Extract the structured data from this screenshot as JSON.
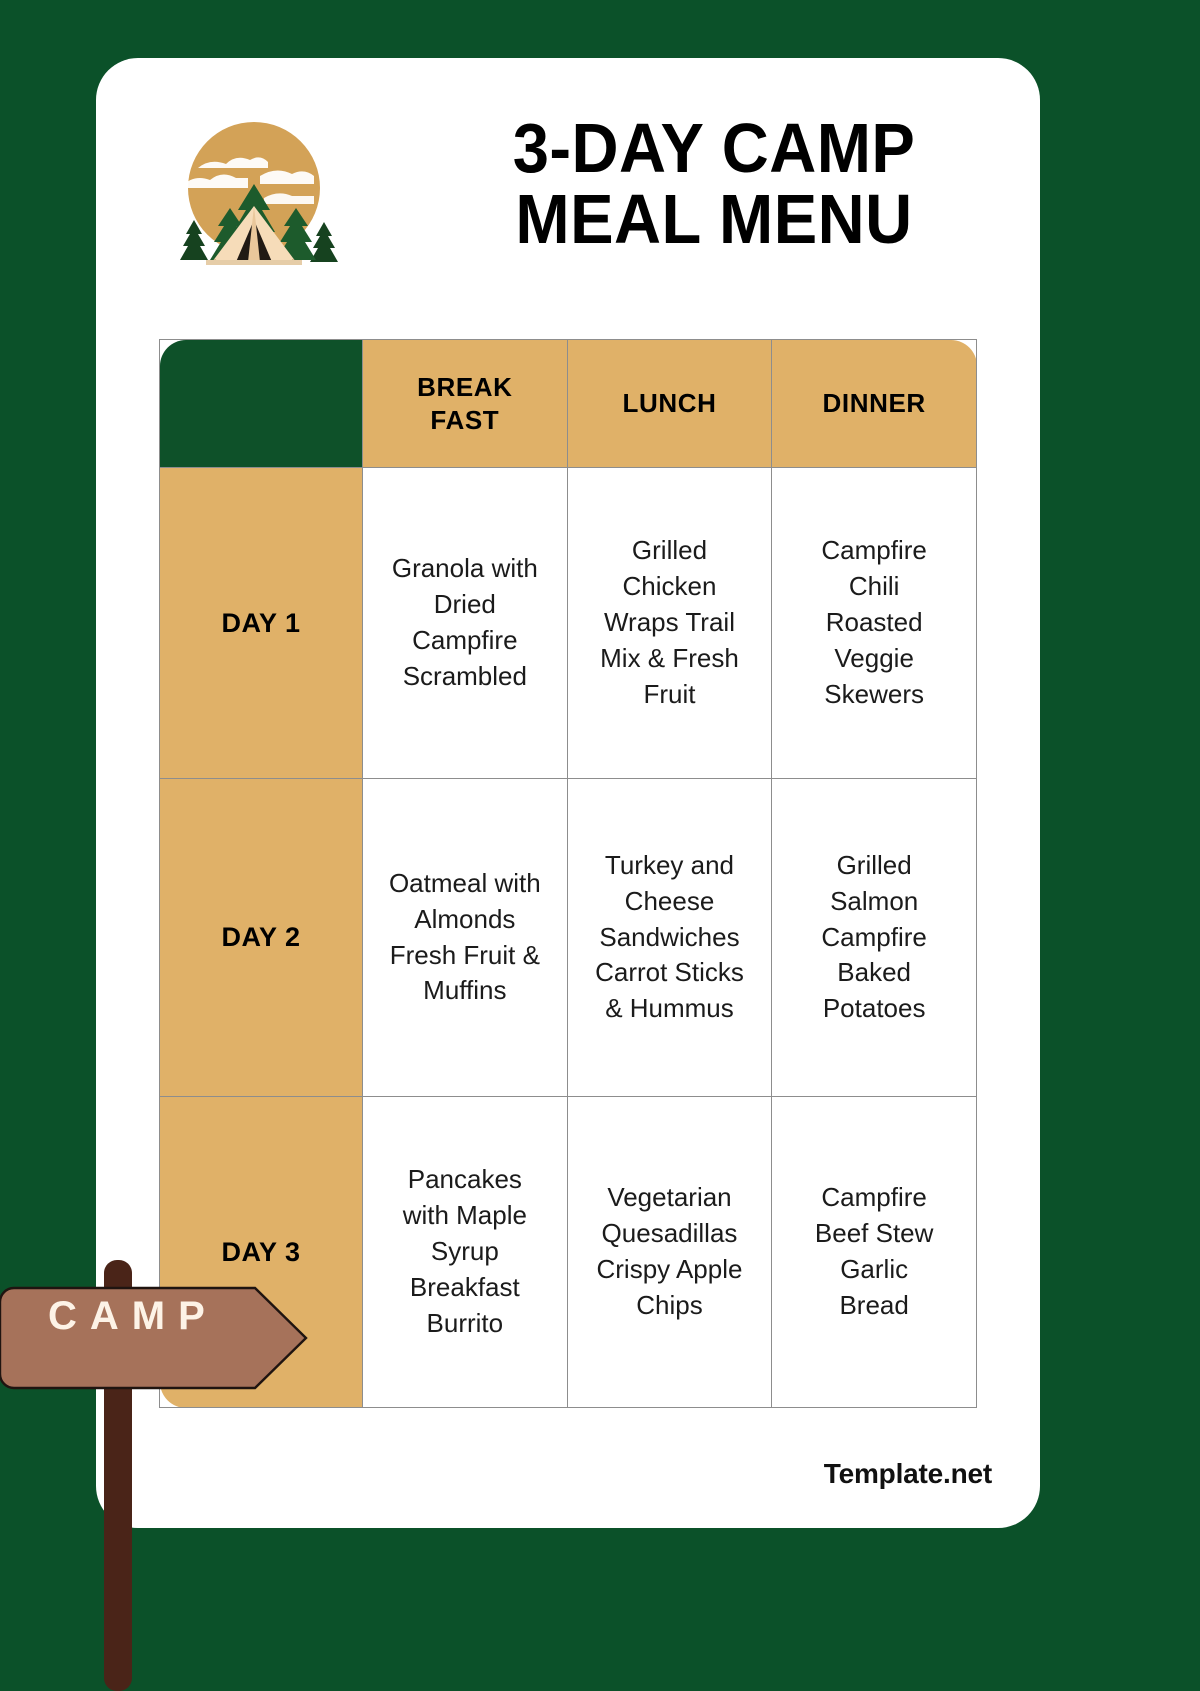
{
  "page": {
    "background_color": "#0b5129",
    "card_color": "#ffffff"
  },
  "header": {
    "title_line1": "3-DAY CAMP",
    "title_line2": "MEAL MENU",
    "logo_name": "camp-tent-forest-logo"
  },
  "colors": {
    "green": "#0b5129",
    "header_green": "#0e5129",
    "tan": "#e0b168",
    "sign_brown": "#a6725a",
    "post_brown": "#4a2418",
    "cream": "#fdf3e7",
    "text": "#1b1b1b"
  },
  "table": {
    "corner_label": "",
    "columns": [
      {
        "key": "breakfast",
        "label": "BREAK FAST"
      },
      {
        "key": "lunch",
        "label": "LUNCH"
      },
      {
        "key": "dinner",
        "label": "DINNER"
      }
    ],
    "rows": [
      {
        "day": "DAY 1",
        "breakfast": "Granola with Dried Campfire Scrambled",
        "lunch": "Grilled Chicken Wraps Trail Mix & Fresh Fruit",
        "dinner": "Campfire Chili Roasted Veggie Skewers"
      },
      {
        "day": "DAY 2",
        "breakfast": "Oatmeal with Almonds Fresh Fruit & Muffins",
        "lunch": "Turkey and Cheese Sandwiches Carrot Sticks & Hummus",
        "dinner": "Grilled Salmon Campfire Baked Potatoes"
      },
      {
        "day": "DAY 3",
        "breakfast": "Pancakes with Maple Syrup Breakfast Burrito",
        "lunch": "Vegetarian Quesadillas Crispy Apple Chips",
        "dinner": "Campfire Beef Stew Garlic Bread"
      }
    ]
  },
  "signpost": {
    "label": "CAMP",
    "name": "camp-direction-signpost"
  },
  "footer": {
    "brand": "Template.net"
  }
}
